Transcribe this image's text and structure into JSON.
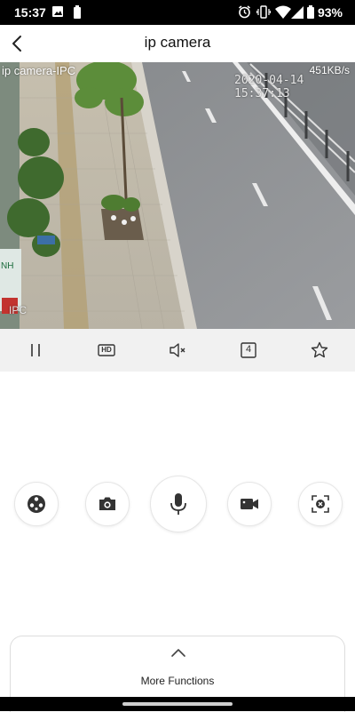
{
  "status_bar": {
    "time": "15:37",
    "battery_percent": "93%",
    "icons": [
      "image-icon",
      "battery-saver-icon",
      "alarm-icon",
      "vibrate-icon",
      "wifi-icon",
      "signal-icon",
      "battery-icon"
    ]
  },
  "header": {
    "title": "ip camera",
    "back_icon": "chevron-left-icon"
  },
  "video": {
    "camera_name": "ip camera-IPC",
    "bitrate": "451KB/s",
    "timestamp": "2020-04-14 15:37:13",
    "watermark": "IPC"
  },
  "controls": [
    {
      "name": "pause-button",
      "icon": "pause-icon"
    },
    {
      "name": "hd-quality-button",
      "icon": "hd-icon",
      "label": "HD"
    },
    {
      "name": "mute-button",
      "icon": "speaker-muted-icon"
    },
    {
      "name": "split-screen-button",
      "icon": "four-icon",
      "label": "4"
    },
    {
      "name": "favorite-button",
      "icon": "star-icon"
    }
  ],
  "actions": [
    {
      "name": "pan-tilt-button",
      "icon": "ptz-icon"
    },
    {
      "name": "snapshot-button",
      "icon": "camera-icon"
    },
    {
      "name": "talk-button",
      "icon": "microphone-icon"
    },
    {
      "name": "record-button",
      "icon": "video-camera-icon"
    },
    {
      "name": "zoom-button",
      "icon": "zoom-frame-icon"
    }
  ],
  "more_functions": {
    "label": "More Functions",
    "icon": "chevron-up-icon"
  },
  "colors": {
    "accent": "#111111",
    "control_bar_bg": "#f1f1f1",
    "status_bar_bg": "#000000"
  }
}
